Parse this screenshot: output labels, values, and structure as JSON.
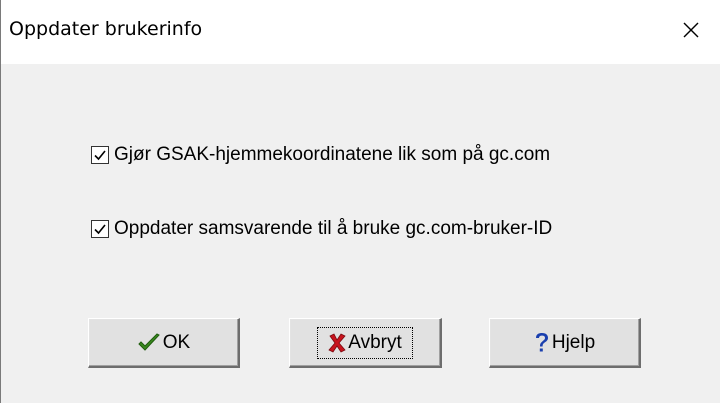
{
  "window": {
    "title": "Oppdater brukerinfo",
    "close_icon": "close-icon"
  },
  "options": [
    {
      "label": "Gjør GSAK-hjemmekoordinatene lik som på gc.com",
      "checked": true
    },
    {
      "label": "Oppdater samsvarende til å bruke gc.com-bruker-ID",
      "checked": true
    }
  ],
  "buttons": {
    "ok_label": "OK",
    "cancel_label": "Avbryt",
    "help_label": "Hjelp"
  },
  "icons": {
    "ok": "checkmark-icon",
    "cancel": "red-x-icon",
    "help": "question-mark-icon"
  },
  "colors": {
    "ok_check": "#3a8a1e",
    "cancel_x": "#c8141e",
    "help_q": "#1a3fae"
  }
}
